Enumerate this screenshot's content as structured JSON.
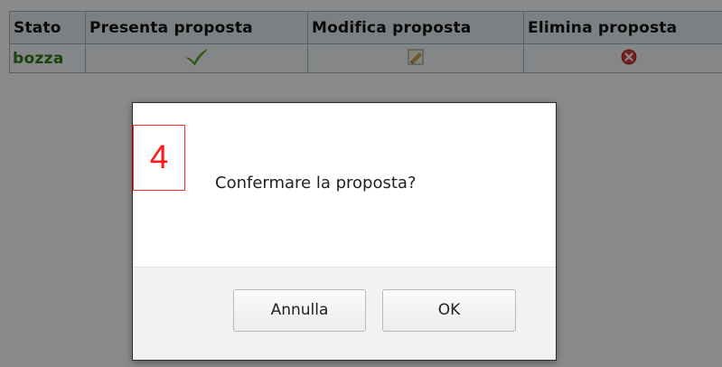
{
  "table": {
    "headers": [
      "Stato",
      "Presenta proposta",
      "Modifica proposta",
      "Elimina proposta"
    ],
    "row": {
      "state": "bozza",
      "present_icon": "checkmark-icon",
      "edit_icon": "edit-icon",
      "delete_icon": "delete-icon"
    }
  },
  "dialog": {
    "step_marker": "4",
    "message": "Confermare la proposta?",
    "cancel_label": "Annulla",
    "ok_label": "OK"
  },
  "colors": {
    "state_text": "#2f7a18",
    "step_marker": "#ff1a1a",
    "overlay": "rgba(0,0,0,0.46)"
  }
}
